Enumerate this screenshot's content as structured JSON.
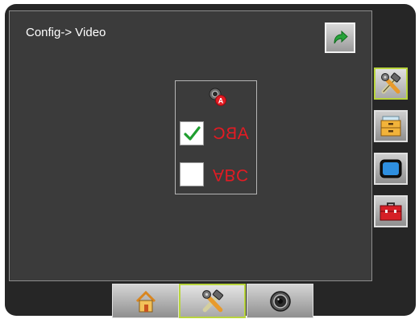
{
  "screen": {
    "title": "Config-> Video"
  },
  "video_settings": {
    "camera_icon": "camera-a-icon",
    "options": [
      {
        "label": "ABC",
        "checked": true,
        "orientation": "mirrored"
      },
      {
        "label": "ABC",
        "checked": false,
        "orientation": "flipped"
      }
    ]
  },
  "side_tabs": [
    {
      "icon": "tools-icon",
      "active": true
    },
    {
      "icon": "file-cabinet-icon",
      "active": false
    },
    {
      "icon": "display-icon",
      "active": false
    },
    {
      "icon": "toolbox-icon",
      "active": false
    }
  ],
  "bottom_tabs": [
    {
      "icon": "home-icon",
      "active": false
    },
    {
      "icon": "tools-icon",
      "active": true
    },
    {
      "icon": "camera-icon",
      "active": false
    }
  ],
  "colors": {
    "accent": "#b9d53d",
    "abc_text": "#e31b23",
    "check": "#1f9e2f",
    "back_arrow": "#27a33a"
  }
}
